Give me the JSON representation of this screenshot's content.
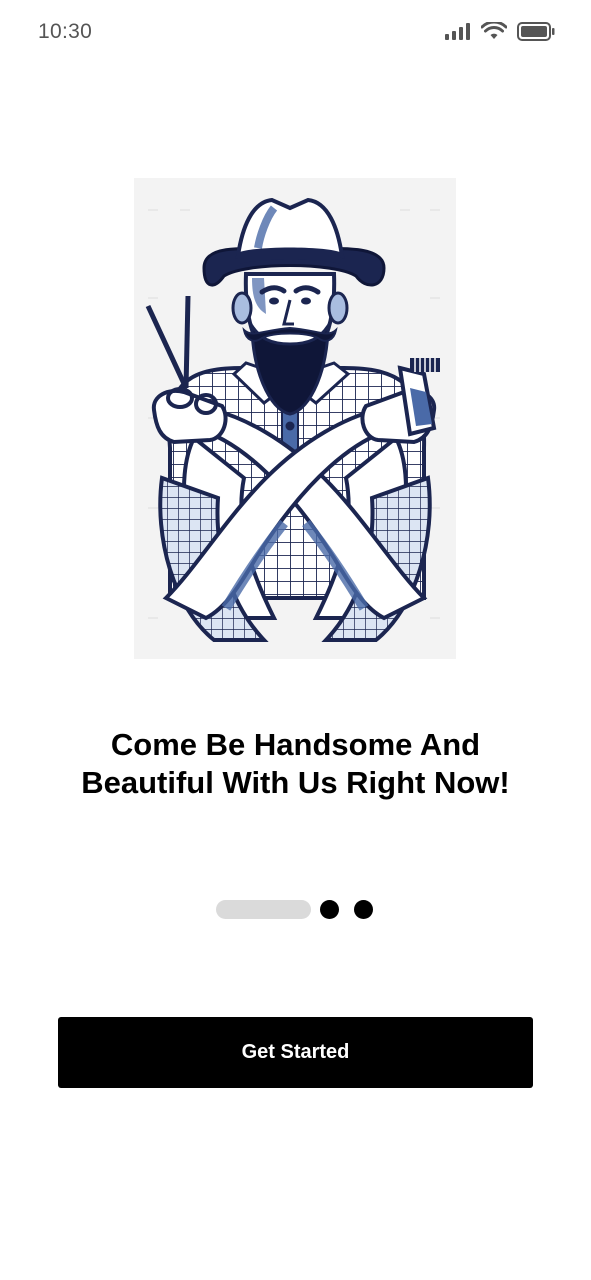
{
  "status_bar": {
    "time": "10:30",
    "icons": [
      "signal-icon",
      "wifi-icon",
      "battery-icon"
    ]
  },
  "illustration": {
    "subject": "bearded-barber-with-scissors-and-clipper",
    "colors": {
      "navy": "#1b2550",
      "mid_blue": "#4a6aa8",
      "light_blue": "#a9bde0",
      "background": "#f3f3f3"
    }
  },
  "onboarding": {
    "headline_line1": "Come Be Handsome And",
    "headline_line2": "Beautiful With Us Right Now!",
    "page_count": 3,
    "active_page": 1
  },
  "cta": {
    "label": "Get Started"
  },
  "colors": {
    "primary": "#000000",
    "indicator_inactive": "#dadada",
    "background": "#ffffff"
  }
}
